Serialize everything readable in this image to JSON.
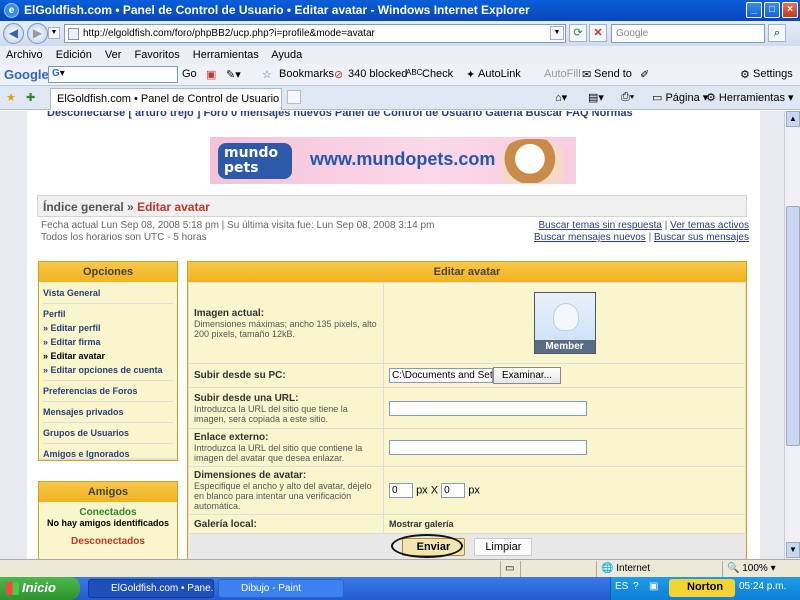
{
  "window": {
    "title": "ElGoldfish.com • Panel de Control de Usuario • Editar avatar - Windows Internet Explorer"
  },
  "address": {
    "url": "http://elgoldfish.com/foro/phpBB2/ucp.php?i=profile&mode=avatar",
    "search_placeholder": "Google"
  },
  "menu": [
    "Archivo",
    "Edición",
    "Ver",
    "Favoritos",
    "Herramientas",
    "Ayuda"
  ],
  "googlebar": {
    "logo": "Google",
    "go": "Go",
    "bookmarks": "Bookmarks",
    "blocked": "340 blocked",
    "check": "Check",
    "autolink": "AutoLink",
    "autofill": "AutoFill",
    "sendto": "Send to",
    "settings": "Settings"
  },
  "tabbar": {
    "tab_title": "ElGoldfish.com • Panel de Control de Usuario • Editar ...",
    "pagina": "Página",
    "herramientas": "Herramientas"
  },
  "site": {
    "topnav": "Desconectarse [ arturo trejo ]   Foro   0 mensajes nuevos   Panel de Control de Usuario   Galería   Buscar   FAQ   Normas",
    "banner": {
      "logo_line1": "mundo",
      "logo_line2": "pets",
      "url": "www.mundopets.com"
    },
    "breadcrumb": {
      "home": "Índice general",
      "sep": "»",
      "current": "Editar avatar"
    },
    "info": {
      "line1": "Fecha actual Lun Sep 08, 2008 5:18 pm | Su última visita fue: Lun Sep 08, 2008 3:14 pm",
      "line2": "Todos los horarios son UTC - 5 horas",
      "link1": "Buscar temas sin respuesta",
      "link2": "Ver temas activos",
      "link3": "Buscar mensajes nuevos",
      "link4": "Buscar sus mensajes",
      "pipe": "|"
    },
    "opciones": {
      "title": "Opciones",
      "vista": "Vista General",
      "perfil": "Perfil",
      "items": [
        "» Editar perfil",
        "» Editar firma",
        "» Editar avatar",
        "» Editar opciones de cuenta"
      ],
      "prefs": "Preferencias de Foros",
      "mp": "Mensajes privados",
      "grupos": "Grupos de Usuarios",
      "amigos": "Amigos e Ignorados"
    },
    "amigos": {
      "title": "Amigos",
      "conectados": "Conectados",
      "none": "No hay amigos identificados",
      "desconectados": "Desconectados"
    },
    "form": {
      "title": "Editar avatar",
      "current_label": "Imagen actual:",
      "current_desc": "Dimensiones máximas; ancho 135 pixels, alto 200 pixels, tamaño 12kB.",
      "avatar_caption": "Member",
      "upload_label": "Subir desde su PC:",
      "upload_value": "C:\\Documents and Set",
      "browse": "Examinar...",
      "url_label": "Subir desde una URL:",
      "url_desc": "Introduzca la URL del sitio que tiene la imagen, será copiada a este sitio.",
      "ext_label": "Enlace externo:",
      "ext_desc": "Introduzca la URL del sitio que contiene la imagen del avatar que desea enlazar.",
      "dim_label": "Dimensiones de avatar:",
      "dim_desc": "Especifique el ancho y alto del avatar, déjelo en blanco para intentar una verificación automática.",
      "w": "0",
      "h": "0",
      "px1": "px X",
      "px2": "px",
      "gallery_label": "Galería local:",
      "gallery_link": "Mostrar galería",
      "submit": "Enviar",
      "reset": "Limpiar"
    }
  },
  "status": {
    "zone": "Internet",
    "zoom": "100%"
  },
  "taskbar": {
    "start": "Inicio",
    "task1": "ElGoldfish.com • Pane...",
    "task2": "Dibujo - Paint",
    "lang": "ES",
    "norton": "Norton",
    "time": "05:24 p.m."
  }
}
